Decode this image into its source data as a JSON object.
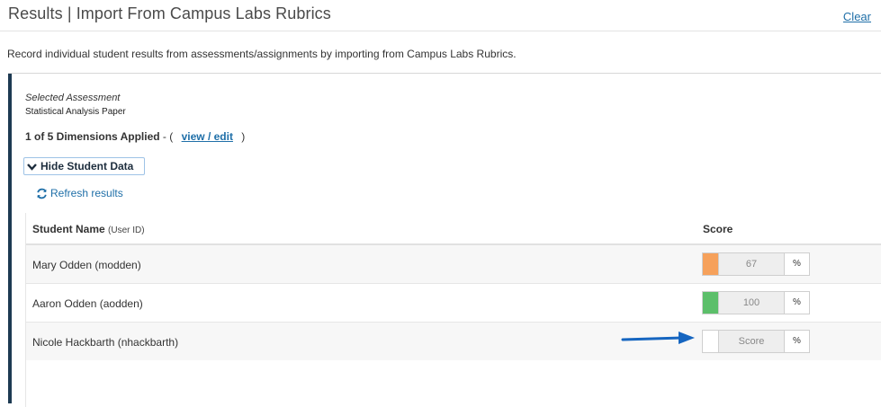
{
  "header": {
    "title": "Results | Import From Campus Labs Rubrics",
    "clear_label": "Clear"
  },
  "description": "Record individual student results from assessments/assignments by importing from Campus Labs Rubrics.",
  "assessment": {
    "selected_label": "Selected Assessment",
    "name": "Statistical Analysis Paper",
    "dimensions_text": "1 of 5 Dimensions Applied",
    "dimensions_open": "- (",
    "view_edit_label": "view / edit",
    "dimensions_close": ")"
  },
  "toggle_label": "Hide Student Data",
  "refresh_label": "Refresh results",
  "table": {
    "col_name": "Student Name",
    "col_name_sub": "(User ID)",
    "col_score": "Score",
    "rows": [
      {
        "name": "Mary Odden (modden)",
        "score": "67",
        "pct": "%",
        "fill_color": "#f6a15b"
      },
      {
        "name": "Aaron Odden (aodden)",
        "score": "100",
        "pct": "%",
        "fill_color": "#5cbf6a"
      },
      {
        "name": "Nicole Hackbarth (nhackbarth)",
        "score": "Score",
        "pct": "%",
        "fill_color": "#ffffff"
      }
    ]
  },
  "colors": {
    "accent_dark": "#1d3a52",
    "link": "#1f6fa8",
    "arrow": "#1565c0"
  }
}
